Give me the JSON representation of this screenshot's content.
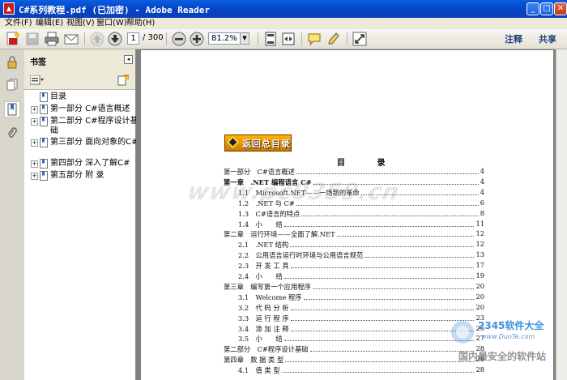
{
  "window": {
    "title": "C#系列教程.pdf (已加密) - Adobe Reader"
  },
  "menu": [
    "文件(F)",
    "编辑(E)",
    "视图(V)",
    "窗口(W)",
    "帮助(H)"
  ],
  "toolbar": {
    "page_current": "1",
    "page_total": "/ 300",
    "zoom": "81.2%",
    "comment_label": "注释",
    "share_label": "共享"
  },
  "bookmarks": {
    "header": "书签",
    "items": [
      {
        "label": "目录",
        "expandable": false
      },
      {
        "label": "第一部分 C#语言概述",
        "expandable": true
      },
      {
        "label": "第二部分 C#程序设计基础",
        "expandable": true
      },
      {
        "label": "第三部分 面向对象的C#",
        "expandable": true
      },
      {
        "label": "第四部分 深入了解C#",
        "expandable": true
      },
      {
        "label": "第五部分 附 录",
        "expandable": true
      }
    ]
  },
  "document": {
    "banner": "返回总目录",
    "toc_title": "目 录",
    "toc": [
      {
        "text": "第一部分　C#语言概述",
        "page": "4",
        "level": 0,
        "bold": false
      },
      {
        "text": "第一章　.NET 编程语言 C#",
        "page": "4",
        "level": 0,
        "bold": true
      },
      {
        "text": "1.1　Microsoft.NET——一场新的革命",
        "page": "4",
        "level": 1,
        "bold": false
      },
      {
        "text": "1.2　.NET 与 C#",
        "page": "6",
        "level": 1,
        "bold": false
      },
      {
        "text": "1.3　C#语言的特点",
        "page": "8",
        "level": 1,
        "bold": false
      },
      {
        "text": "1.4　小　　结",
        "page": "11",
        "level": 1,
        "bold": false
      },
      {
        "text": "第二章　运行环境——全面了解.NET",
        "page": "12",
        "level": 0,
        "bold": false
      },
      {
        "text": "2.1　.NET 结构",
        "page": "12",
        "level": 1,
        "bold": false
      },
      {
        "text": "2.2　公用语言运行时环境与公用语言规范",
        "page": "13",
        "level": 1,
        "bold": false
      },
      {
        "text": "2.3　开 发 工 具",
        "page": "17",
        "level": 1,
        "bold": false
      },
      {
        "text": "2.4　小　　结",
        "page": "19",
        "level": 1,
        "bold": false
      },
      {
        "text": "第三章　编写第一个应用程序",
        "page": "20",
        "level": 0,
        "bold": false
      },
      {
        "text": "3.1　Welcome 程序",
        "page": "20",
        "level": 1,
        "bold": false
      },
      {
        "text": "3.2　代 码 分 析",
        "page": "20",
        "level": 1,
        "bold": false
      },
      {
        "text": "3.3　运 行 程 序",
        "page": "23",
        "level": 1,
        "bold": false
      },
      {
        "text": "3.4　添 加 注 释",
        "page": "25",
        "level": 1,
        "bold": false
      },
      {
        "text": "3.5　小　　结",
        "page": "27",
        "level": 1,
        "bold": false
      },
      {
        "text": "第二部分　C#程序设计基础",
        "page": "28",
        "level": 0,
        "bold": false
      },
      {
        "text": "第四章　数 据 类 型",
        "page": "28",
        "level": 0,
        "bold": false
      },
      {
        "text": "4.1　值 类 型",
        "page": "28",
        "level": 1,
        "bold": false
      }
    ]
  },
  "watermark": {
    "center": "www.pc0359.cn",
    "brand": "2345软件大全",
    "url": "www.DuoTe.com",
    "slogan": "国内最安全的软件站"
  }
}
